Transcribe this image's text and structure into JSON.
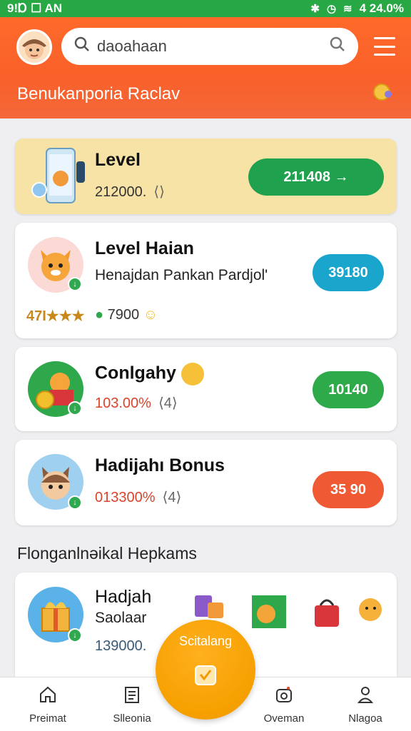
{
  "status_bar": {
    "left": "9!Ɒ ☐ AN",
    "time": "4 24.0%"
  },
  "header": {
    "search_value": "daoahaan",
    "title": "Benukanporia Raclav"
  },
  "cards": [
    {
      "title": "Level",
      "meta": "212000.",
      "meta_extra": "⟨⟩",
      "action": "211408 →",
      "action_color": "#1fa14d"
    },
    {
      "title": "Level Haian",
      "subtitle": "Henajdan Pankan Pardjol'",
      "rating": "47Ɩ★★★",
      "coins": "7900",
      "action": "39180",
      "action_color": "#1aa6cc"
    },
    {
      "title": "Conlgahy",
      "meta": "103.00%",
      "meta_extra": "⟨4⟩",
      "action": "10140",
      "action_color": "#2eaa4a"
    },
    {
      "title": "Hadijahı Bonus",
      "meta": "013300%",
      "meta_extra": "⟨4⟩",
      "action": "35 90",
      "action_color": "#ef5a35"
    }
  ],
  "section": {
    "title": "Flonganlnəikal Hepkams"
  },
  "list_card": {
    "title": "Hadjah",
    "subtitle": "Saolaar",
    "meta": "139000."
  },
  "bottom_nav": [
    {
      "label": "Preimat",
      "icon": "home-icon"
    },
    {
      "label": "Slleonia",
      "icon": "document-icon"
    },
    {
      "label": "Oveman",
      "icon": "camera-icon"
    },
    {
      "label": "Nlagoa",
      "icon": "person-icon"
    }
  ],
  "fab": {
    "label": "Scitalang"
  }
}
